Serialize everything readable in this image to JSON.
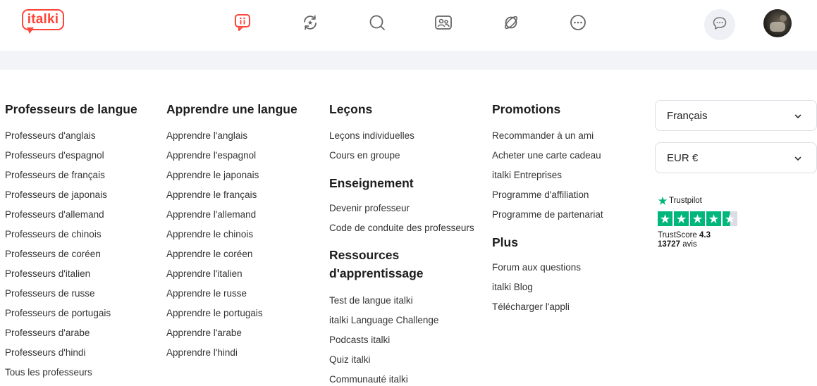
{
  "header": {
    "logo_text": "italki",
    "brand_color": "#ff4438",
    "nav_icons": [
      "italki-home-icon",
      "exchange-icon",
      "search-icon",
      "community-icon",
      "planet-icon",
      "more-icon"
    ],
    "active_icon": "italki-home-icon"
  },
  "columns": {
    "teachers": {
      "title": "Professeurs de langue",
      "links": [
        "Professeurs d'anglais",
        "Professeurs d'espagnol",
        "Professeurs de français",
        "Professeurs de japonais",
        "Professeurs d'allemand",
        "Professeurs de chinois",
        "Professeurs de coréen",
        "Professeurs d'italien",
        "Professeurs de russe",
        "Professeurs de portugais",
        "Professeurs d'arabe",
        "Professeurs d'hindi",
        "Tous les professeurs"
      ]
    },
    "learn": {
      "title": "Apprendre une langue",
      "links": [
        "Apprendre l'anglais",
        "Apprendre l'espagnol",
        "Apprendre le japonais",
        "Apprendre le français",
        "Apprendre l'allemand",
        "Apprendre le chinois",
        "Apprendre le coréen",
        "Apprendre l'italien",
        "Apprendre le russe",
        "Apprendre le portugais",
        "Apprendre l'arabe",
        "Apprendre l'hindi"
      ]
    },
    "lessons": {
      "title": "Leçons",
      "links": [
        "Leçons individuelles",
        "Cours en groupe"
      ],
      "teaching_title": "Enseignement",
      "teaching_links": [
        "Devenir professeur",
        "Code de conduite des professeurs"
      ],
      "resources_title_line1": "Ressources",
      "resources_title_line2": "d'apprentissage",
      "resources_links": [
        "Test de langue italki",
        "italki Language Challenge",
        "Podcasts italki",
        "Quiz italki",
        "Communauté italki"
      ]
    },
    "promotions": {
      "title": "Promotions",
      "links": [
        "Recommander à un ami",
        "Acheter une carte cadeau",
        "italki Entreprises",
        "Programme d'affiliation",
        "Programme de partenariat"
      ],
      "more_title": "Plus",
      "more_links": [
        "Forum aux questions",
        "italki Blog",
        "Télécharger l'appli"
      ]
    }
  },
  "settings": {
    "language_value": "Français",
    "currency_value": "EUR €"
  },
  "trustpilot": {
    "brand": "Trustpilot",
    "score_label": "TrustScore",
    "score": "4.3",
    "reviews_count": "13727",
    "reviews_label": "avis",
    "stars_filled": 4.5,
    "color": "#00b67a"
  }
}
